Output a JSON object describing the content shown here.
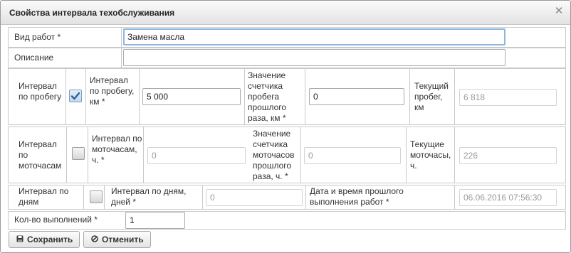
{
  "dialog": {
    "title": "Свойства интервала техобслуживания",
    "close_glyph": "✕"
  },
  "work_type": {
    "label": "Вид работ *",
    "value": "Замена масла"
  },
  "description": {
    "label": "Описание",
    "value": ""
  },
  "mileage": {
    "toggle_label": "Интервал по пробегу",
    "checked": true,
    "interval_label": "Интервал по пробегу, км *",
    "interval_value": "5 000",
    "last_label": "Значение счетчика пробега прошлого раза, км *",
    "last_value": "0",
    "current_label": "Текущий пробег, км",
    "current_value": "6 818"
  },
  "engine_hours": {
    "toggle_label": "Интервал по моточасам",
    "checked": false,
    "interval_label": "Интервал по моточасам, ч. *",
    "interval_value": "0",
    "last_label": "Значение счетчика моточасов прошлого раза, ч. *",
    "last_value": "0",
    "current_label": "Текущие моточасы, ч.",
    "current_value": "226"
  },
  "days": {
    "toggle_label": "Интервал по дням",
    "checked": false,
    "interval_label": "Интервал по дням, дней *",
    "interval_value": "0",
    "last_label": "Дата и время прошлого выполнения работ *",
    "last_value": "06.06.2016 07:56:30"
  },
  "count": {
    "label": "Кол-во выполнений *",
    "value": "1"
  },
  "buttons": {
    "save_label": "Сохранить",
    "cancel_label": "Отменить"
  },
  "icons": {
    "close": "close-icon",
    "save": "floppy-disk-icon",
    "cancel": "cancel-circle-icon",
    "check": "checkmark-icon"
  },
  "colors": {
    "focus_border": "#8fb6de",
    "titlebar_top": "#fbfbfb",
    "titlebar_bottom": "#e2e2e2",
    "check_mark": "#2f5f93"
  }
}
